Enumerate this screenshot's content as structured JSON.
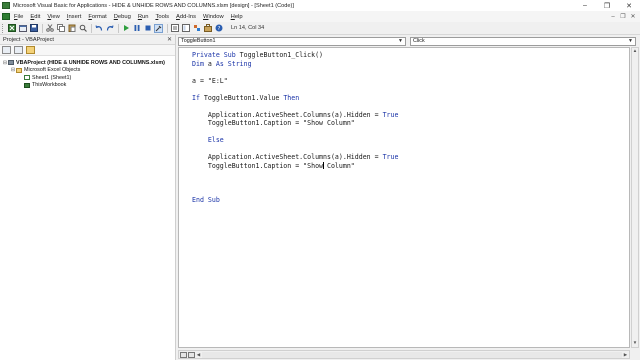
{
  "window": {
    "title": "Microsoft Visual Basic for Applications - HIDE & UNHIDE ROWS AND COLUMNS.xlsm [design] - [Sheet1 (Code)]",
    "controls": [
      "–",
      "❐",
      "✕"
    ]
  },
  "menu": {
    "items": [
      {
        "label": "File",
        "key": "F",
        "rest": "ile"
      },
      {
        "label": "Edit",
        "key": "E",
        "rest": "dit"
      },
      {
        "label": "View",
        "key": "V",
        "rest": "iew"
      },
      {
        "label": "Insert",
        "key": "I",
        "rest": "nsert"
      },
      {
        "label": "Format",
        "key": "F",
        "rest": "ormat",
        "pre": "F",
        "u_index": 1
      },
      {
        "label": "Debug",
        "key": "D",
        "rest": "ebug"
      },
      {
        "label": "Run",
        "key": "R",
        "rest": "un"
      },
      {
        "label": "Tools",
        "key": "T",
        "rest": "ools"
      },
      {
        "label": "Add-Ins",
        "key": "A",
        "rest": "dd-Ins"
      },
      {
        "label": "Window",
        "key": "W",
        "rest": "indow"
      },
      {
        "label": "Help",
        "key": "H",
        "rest": "elp"
      }
    ],
    "mdi_controls": [
      "–",
      "❐",
      "✕"
    ]
  },
  "toolbar": {
    "status": "Ln 14, Col 34"
  },
  "project": {
    "title": "Project - VBAProject",
    "close": "✕",
    "tree": [
      {
        "label": "VBAProject (HIDE & UNHIDE ROWS AND COLUMNS.xlsm)",
        "toggle": "⊟",
        "icon": "project"
      },
      {
        "label": "Microsoft Excel Objects",
        "toggle": "⊟",
        "icon": "folder"
      },
      {
        "label": "Sheet1 (Sheet1)",
        "toggle": "",
        "icon": "sheet"
      },
      {
        "label": "ThisWorkbook",
        "toggle": "",
        "icon": "book"
      }
    ]
  },
  "code_window": {
    "object_combo": "ToggleButton1",
    "procedure_combo": "Click",
    "lines": [
      "Private Sub ToggleButton1_Click()",
      "Dim a As String",
      "",
      "a = \"E:L\"",
      "",
      "If ToggleButton1.Value Then",
      "",
      "    Application.ActiveSheet.Columns(a).Hidden = True",
      "    ToggleButton1.Caption = \"Show Column\"",
      "",
      "    Else",
      "",
      "    Application.ActiveSheet.Columns(a).Hidden = True",
      "    ToggleButton1.Caption = \"Show Column\"",
      "",
      "",
      "",
      "End Sub"
    ]
  }
}
